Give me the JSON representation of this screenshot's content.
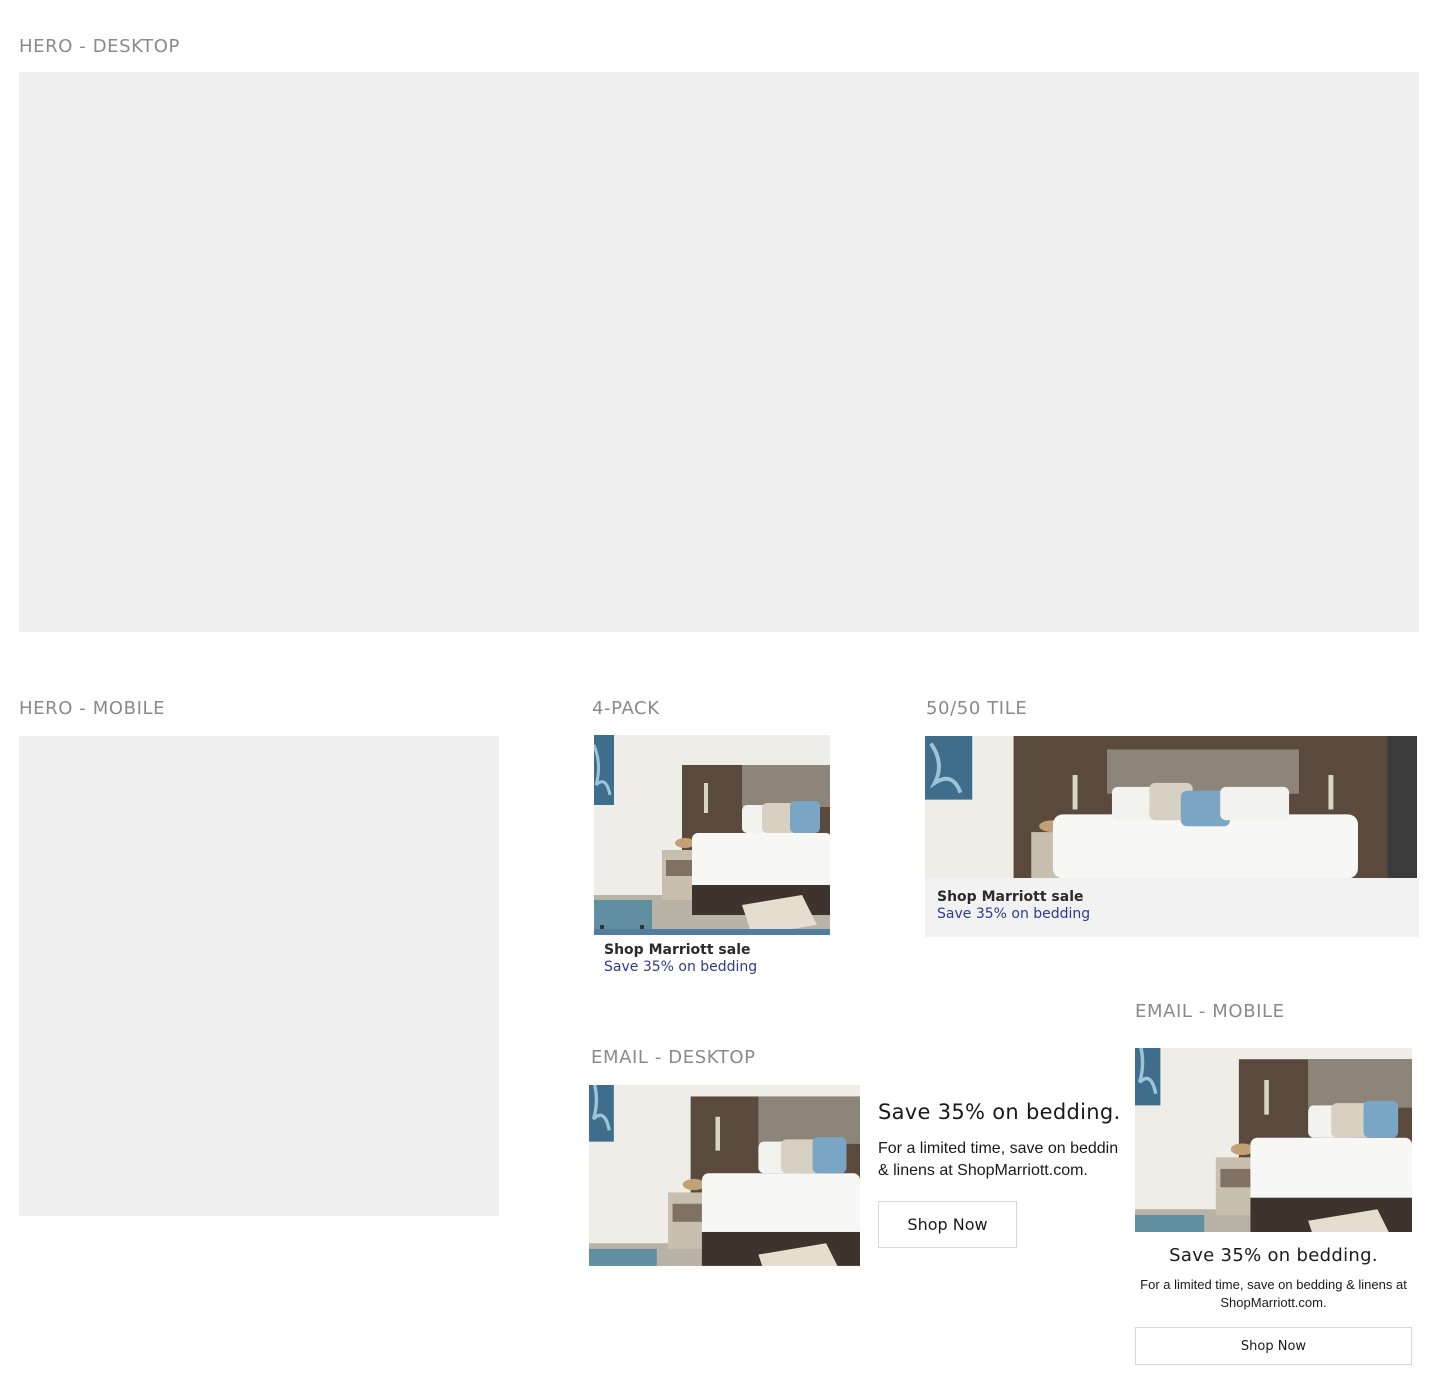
{
  "sections": {
    "hero_desktop": "HERO - DESKTOP",
    "hero_mobile": "HERO - MOBILE",
    "four_pack": "4-PACK",
    "fifty_tile": "50/50 TILE",
    "email_desktop": "EMAIL - DESKTOP",
    "email_mobile": "EMAIL - MOBILE"
  },
  "four_pack": {
    "title": "Shop Marriott sale",
    "subtitle": "Save 35% on bedding"
  },
  "fifty_tile": {
    "title": "Shop Marriott sale",
    "subtitle": "Save 35% on bedding"
  },
  "email_desktop": {
    "headline": "Save 35% on bedding.",
    "body_line1": "For a limited time, save on beddin",
    "body_line2": "& linens at ShopMarriott.com.",
    "cta": "Shop Now"
  },
  "email_mobile": {
    "headline": "Save 35% on bedding.",
    "body_line1": "For a limited time, save on bedding & linens at",
    "body_line2": "ShopMarriott.com.",
    "cta": "Shop Now"
  },
  "colors": {
    "placeholder": "#f0f0f0",
    "section_label": "#8a8a8a",
    "link_blue": "#2f3b8f",
    "tile_bar": "#f2f2f2"
  }
}
